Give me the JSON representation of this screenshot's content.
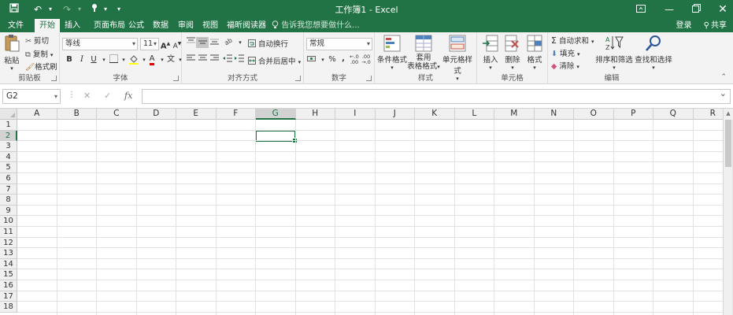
{
  "window": {
    "title": "工作簿1 - Excel",
    "qa_icons": [
      "save-icon",
      "undo-icon",
      "redo-icon",
      "touch-mode-icon",
      "customize-icon"
    ],
    "controls": [
      "ribbon-display-icon",
      "minimize-icon",
      "restore-icon",
      "close-icon"
    ]
  },
  "tabs": [
    {
      "label": "文件"
    },
    {
      "label": "开始",
      "active": true
    },
    {
      "label": "插入"
    },
    {
      "label": "页面布局"
    },
    {
      "label": "公式"
    },
    {
      "label": "数据"
    },
    {
      "label": "审阅"
    },
    {
      "label": "视图"
    },
    {
      "label": "福昕阅读器"
    }
  ],
  "tell_me": "告诉我您想要做什么...",
  "account": {
    "login": "登录",
    "share": "共享"
  },
  "ribbon": {
    "clipboard": {
      "label": "剪贴板",
      "paste": "粘贴",
      "cut": "剪切",
      "copy": "复制",
      "format_painter": "格式刷"
    },
    "font": {
      "label": "字体",
      "font_name": "等线",
      "font_size": "11",
      "bold": "B",
      "italic": "I",
      "underline": "U",
      "wen": "文",
      "grow": "A",
      "shrink": "A"
    },
    "alignment": {
      "label": "对齐方式",
      "wrap": "自动换行",
      "merge": "合并后居中"
    },
    "number": {
      "label": "数字",
      "format": "常规",
      "percent": "%",
      "comma": ","
    },
    "styles": {
      "label": "样式",
      "conditional": "条件格式",
      "table_line1": "套用",
      "table_line2": "表格格式",
      "cell_styles": "单元格样式"
    },
    "cells": {
      "label": "单元格",
      "insert": "插入",
      "delete": "删除",
      "format": "格式"
    },
    "editing": {
      "label": "编辑",
      "autosum": "自动求和",
      "fill": "填充",
      "clear": "清除",
      "sort": "排序和筛选",
      "find": "查找和选择"
    }
  },
  "formula_bar": {
    "name_box": "G2",
    "value": ""
  },
  "grid": {
    "columns": [
      "A",
      "B",
      "C",
      "D",
      "E",
      "F",
      "G",
      "H",
      "I",
      "J",
      "K",
      "L",
      "M",
      "N",
      "O",
      "P",
      "Q",
      "R"
    ],
    "rows": [
      "1",
      "2",
      "3",
      "4",
      "5",
      "6",
      "7",
      "8",
      "9",
      "10",
      "11",
      "12",
      "13",
      "14",
      "15",
      "16",
      "17",
      "18"
    ],
    "selected_column": "G",
    "selected_row": "2"
  },
  "colors": {
    "accent": "#217346"
  }
}
